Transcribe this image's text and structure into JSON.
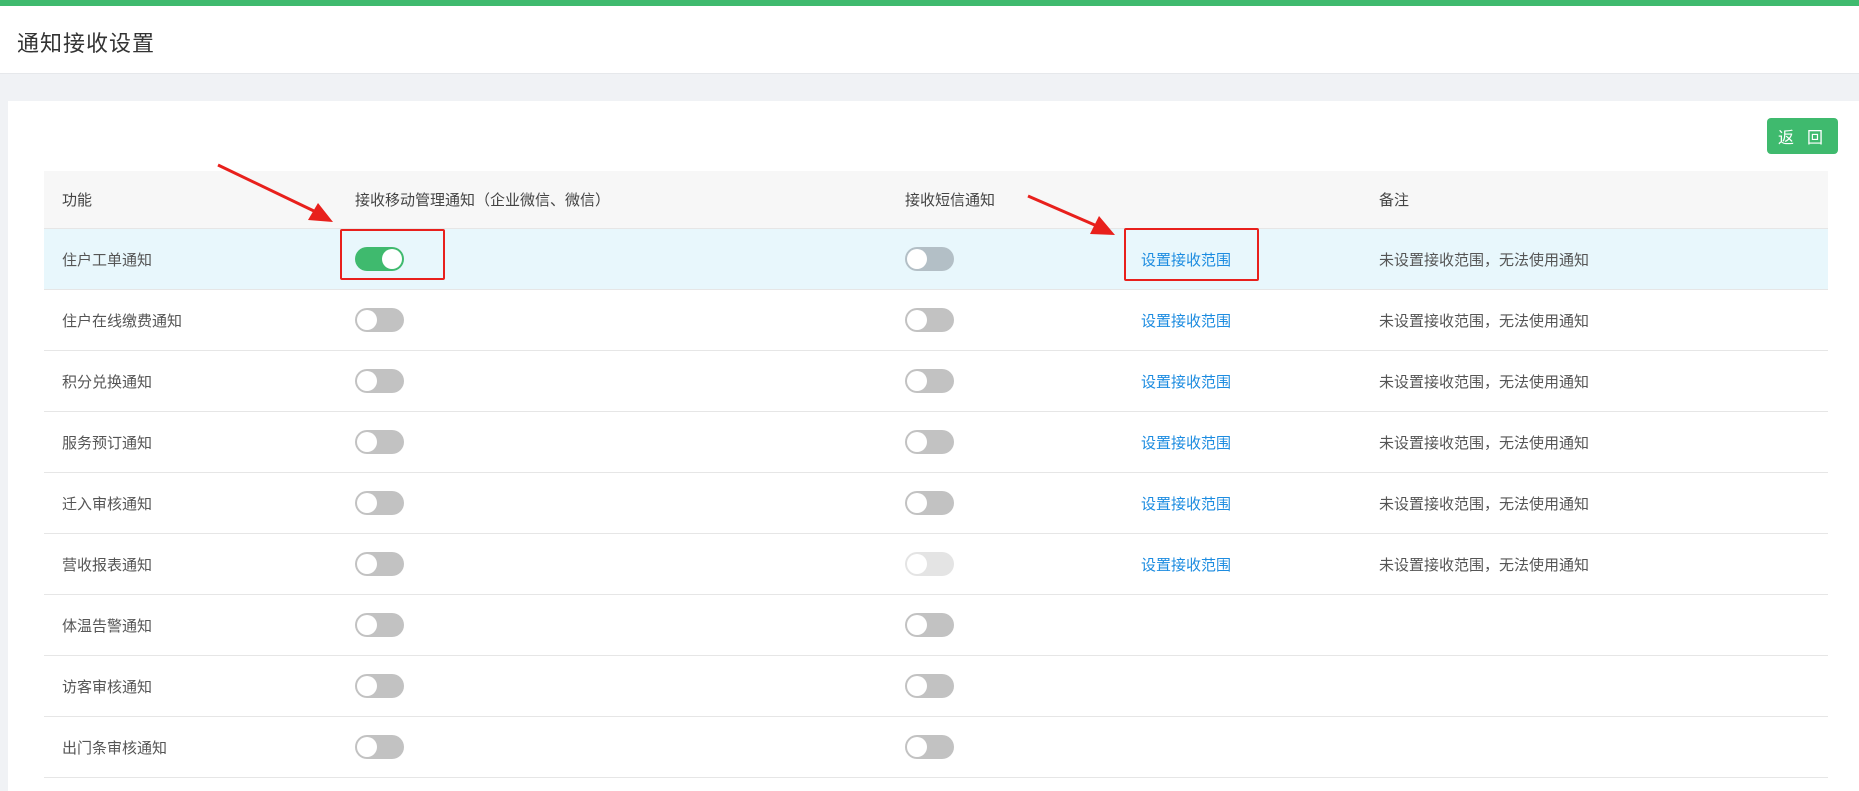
{
  "page": {
    "title": "通知接收设置"
  },
  "toolbar": {
    "back_label": "返 回"
  },
  "colors": {
    "accent": "#3fba6e",
    "link": "#1d8ce0",
    "annotation": "#e8201c",
    "highlight_row": "#e8f7fc"
  },
  "table": {
    "headers": [
      "功能",
      "接收移动管理通知（企业微信、微信）",
      "接收短信通知",
      "",
      "备注"
    ],
    "rows": [
      {
        "name": "住户工单通知",
        "mobile_on": true,
        "sms": "off",
        "link": "设置接收范围",
        "note": "未设置接收范围，无法使用通知"
      },
      {
        "name": "住户在线缴费通知",
        "mobile_on": false,
        "sms": "off",
        "link": "设置接收范围",
        "note": "未设置接收范围，无法使用通知"
      },
      {
        "name": "积分兑换通知",
        "mobile_on": false,
        "sms": "off",
        "link": "设置接收范围",
        "note": "未设置接收范围，无法使用通知"
      },
      {
        "name": "服务预订通知",
        "mobile_on": false,
        "sms": "off",
        "link": "设置接收范围",
        "note": "未设置接收范围，无法使用通知"
      },
      {
        "name": "迁入审核通知",
        "mobile_on": false,
        "sms": "off",
        "link": "设置接收范围",
        "note": "未设置接收范围，无法使用通知"
      },
      {
        "name": "营收报表通知",
        "mobile_on": false,
        "sms": "disabled",
        "link": "设置接收范围",
        "note": "未设置接收范围，无法使用通知"
      },
      {
        "name": "体温告警通知",
        "mobile_on": false,
        "sms": "off",
        "link": "",
        "note": ""
      },
      {
        "name": "访客审核通知",
        "mobile_on": false,
        "sms": "off",
        "link": "",
        "note": ""
      },
      {
        "name": "出门条审核通知",
        "mobile_on": false,
        "sms": "off",
        "link": "",
        "note": ""
      }
    ]
  }
}
